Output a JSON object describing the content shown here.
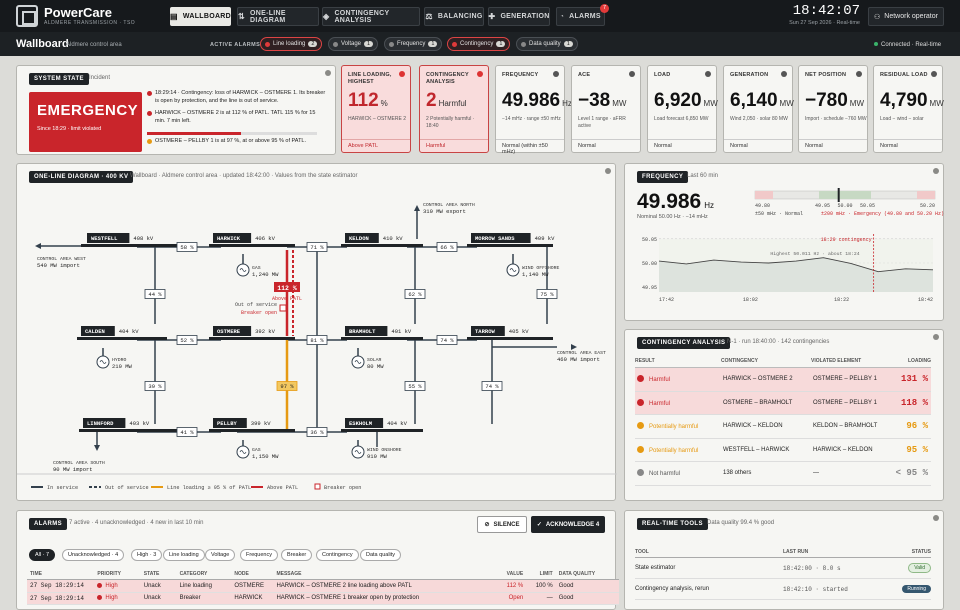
{
  "app": {
    "name": "PowerCare",
    "subtitle": "ALDMERE TRANSMISSION · TSO"
  },
  "nav": [
    {
      "label": "WALLBOARD",
      "icon": "▤"
    },
    {
      "label": "ONE-LINE DIAGRAM",
      "icon": "⇅"
    },
    {
      "label": "CONTINGENCY ANALYSIS",
      "icon": "◈"
    },
    {
      "label": "BALANCING",
      "icon": "⚖"
    },
    {
      "label": "GENERATION",
      "icon": "✚"
    },
    {
      "label": "ALARMS",
      "icon": "🔔"
    }
  ],
  "nav_badge": "7",
  "clock": {
    "time": "18:42:07",
    "date": "Sun 27 Sep 2026 · Real-time"
  },
  "operator": "Network operator",
  "subbar": {
    "title": "Wallboard",
    "subtitle": "Aldmere control area",
    "active_alarms_label": "ACTIVE ALARMS",
    "connected": "Connected · Real-time"
  },
  "alarm_chips": [
    {
      "label": "Line loading",
      "count": "2",
      "severity": "red"
    },
    {
      "label": "Voltage",
      "count": "1",
      "severity": "grey"
    },
    {
      "label": "Frequency",
      "count": "1",
      "severity": "grey"
    },
    {
      "label": "Contingency",
      "count": "1",
      "severity": "red"
    },
    {
      "label": "Data quality",
      "count": "1",
      "severity": "grey"
    }
  ],
  "system_state": {
    "title": "SYSTEM STATE",
    "tab": "Incident",
    "state": "EMERGENCY",
    "since": "Since 18:29 · limit violated",
    "incidents": [
      {
        "text": "18:29:14 · Contingency: loss of HARWICK – OSTMERE 1. Its breaker is open by protection, and the line is out of service."
      },
      {
        "text": "HARWICK – OSTMERE 2 is at 112 % of PATL. TATL 115 % for 15 min. 7 min left.",
        "progress": 0.55
      },
      {
        "text": "OSTMERE – PELLBY 1 is at 97 %, at or above 95 % of PATL."
      }
    ]
  },
  "kpis": [
    {
      "label": "LINE LOADING, HIGHEST",
      "value": "112",
      "unit": "%",
      "sub": "HARWICK – OSTMERE 2",
      "foot": "Above PATL",
      "alert": true
    },
    {
      "label": "CONTINGENCY ANALYSIS",
      "value": "2",
      "unit": "Harmful",
      "sub": "2 Potentially harmful · 18:40",
      "foot": "Harmful",
      "alert": true
    },
    {
      "label": "FREQUENCY",
      "value": "49.986",
      "unit": "Hz",
      "sub": "−14 mHz · range ±50 mHz",
      "foot": "Normal (within ±50 mHz)",
      "alert": false
    },
    {
      "label": "ACE",
      "value": "−38",
      "unit": "MW",
      "sub": "Level 1 range · aFRR active",
      "foot": "Normal",
      "alert": false
    },
    {
      "label": "LOAD",
      "value": "6,920",
      "unit": "MW",
      "sub": "Load forecast 6,850 MW",
      "foot": "Normal",
      "alert": false
    },
    {
      "label": "GENERATION",
      "value": "6,140",
      "unit": "MW",
      "sub": "Wind 2,050 · solar 80 MW",
      "foot": "Normal",
      "alert": false
    },
    {
      "label": "NET POSITION",
      "value": "−780",
      "unit": "MW",
      "sub": "Import · schedule −760 MW",
      "foot": "Normal",
      "alert": false
    },
    {
      "label": "RESIDUAL LOAD",
      "value": "4,790",
      "unit": "MW",
      "sub": "Load − wind − solar",
      "foot": "Normal",
      "alert": false
    }
  ],
  "one_line": {
    "title": "ONE-LINE DIAGRAM · 400 KV",
    "meta": "Wallboard · Aldmere control area · updated 18:42:00 · Values from the state estimator",
    "buses": [
      {
        "name": "WESTFELL",
        "kv": "408 kV"
      },
      {
        "name": "HARWICK",
        "kv": "406 kV"
      },
      {
        "name": "KELDON",
        "kv": "410 kV"
      },
      {
        "name": "MORROW SANDS",
        "kv": "409 kV"
      },
      {
        "name": "CALDEN",
        "kv": "404 kV"
      },
      {
        "name": "OSTMERE",
        "kv": "392 kV"
      },
      {
        "name": "BRAMHOLT",
        "kv": "401 kV"
      },
      {
        "name": "TARROW",
        "kv": "405 kV"
      },
      {
        "name": "LINNFORD",
        "kv": "403 kV"
      },
      {
        "name": "PELLBY",
        "kv": "399 kV"
      },
      {
        "name": "ESKHOLM",
        "kv": "404 kV"
      }
    ],
    "loadings": [
      "58 %",
      "71 %",
      "66 %",
      "44 %",
      "62 %",
      "75 %",
      "52 %",
      "81 %",
      "74 %",
      "39 %",
      "55 %",
      "74 %",
      "41 %",
      "36 %",
      "97 %",
      "112 %"
    ],
    "overload_label": "Above PATL",
    "out_of_service": "Out of service",
    "breaker_open": "Breaker open",
    "generators": [
      {
        "type": "GAS",
        "mw": "1,240 MW"
      },
      {
        "type": "WIND OFFSHORE",
        "mw": "1,140 MW"
      },
      {
        "type": "HYDRO",
        "mw": "210 MW"
      },
      {
        "type": "SOLAR",
        "mw": "80 MW"
      },
      {
        "type": "GAS",
        "mw": "1,150 MW"
      },
      {
        "type": "WIND ONSHORE",
        "mw": "910 MW"
      }
    ],
    "borders": [
      {
        "label": "CONTROL AREA WEST",
        "mw": "540 MW import"
      },
      {
        "label": "CONTROL AREA NORTH",
        "mw": "310 MW export"
      },
      {
        "label": "CONTROL AREA EAST",
        "mw": "460 MW import"
      },
      {
        "label": "CONTROL AREA SOUTH",
        "mw": "90 MW import"
      }
    ],
    "legend": [
      "In service",
      "Out of service",
      "Line loading ≥ 95 % of PATL",
      "Above PATL",
      "Breaker open"
    ]
  },
  "frequency": {
    "title": "FREQUENCY",
    "meta": "Last 60 min",
    "value": "49.986",
    "unit": "Hz",
    "nominal": "Nominal 50.00 Hz · −14 mHz",
    "scale_ticks": [
      "49.80",
      "49.95",
      "50.00",
      "50.05",
      "50.20"
    ],
    "scale_legend": [
      "±50 mHz · Normal",
      "±200 mHz · Emergency (49.80 and 50.20 Hz)"
    ],
    "chart_data": {
      "type": "line",
      "x": [
        "17:42",
        "17:48",
        "17:54",
        "18:00",
        "18:06",
        "18:12",
        "18:18",
        "18:24",
        "18:30",
        "18:36",
        "18:42"
      ],
      "y": [
        50.004,
        49.998,
        50.006,
        50.002,
        50.0,
        50.004,
        50.011,
        49.999,
        49.982,
        49.988,
        49.986
      ],
      "yticks": [
        "50.05",
        "50.00",
        "49.95"
      ],
      "ylim": [
        49.94,
        50.06
      ],
      "annotations": [
        "Highest 50.011 Hz · about 18:24",
        "18:29 contingency"
      ],
      "xtick_labels": [
        "17:42",
        "18:02",
        "18:22",
        "18:42"
      ]
    }
  },
  "contingency": {
    "title": "CONTINGENCY ANALYSIS",
    "meta": "N-1 · run 18:40:00 · 142 contingencies",
    "headers": [
      "RESULT",
      "CONTINGENCY",
      "VIOLATED ELEMENT",
      "LOADING"
    ],
    "rows": [
      {
        "result": "Harmful",
        "contingency": "HARWICK – OSTMERE 2",
        "violated": "OSTMERE – PELLBY 1",
        "loading": "131 %",
        "level": "red"
      },
      {
        "result": "Harmful",
        "contingency": "OSTMERE – BRAMHOLT",
        "violated": "OSTMERE – PELLBY 1",
        "loading": "118 %",
        "level": "red"
      },
      {
        "result": "Potentially harmful",
        "contingency": "HARWICK – KELDON",
        "violated": "KELDON – BRAMHOLT",
        "loading": "96 %",
        "level": "amber"
      },
      {
        "result": "Potentially harmful",
        "contingency": "WESTFELL – HARWICK",
        "violated": "HARWICK – KELDON",
        "loading": "95 %",
        "level": "amber"
      },
      {
        "result": "Not harmful",
        "contingency": "138 others",
        "violated": "—",
        "loading": "< 95 %",
        "level": "grey"
      }
    ]
  },
  "alarms": {
    "title": "ALARMS",
    "meta": "7 active · 4 unacknowledged · 4 new in last 10 min",
    "silence": "SILENCE",
    "ack": "ACKNOWLEDGE 4",
    "filters": [
      "All · 7",
      "Unacknowledged · 4",
      "High · 3",
      "Line loading",
      "Voltage",
      "Frequency",
      "Breaker",
      "Contingency",
      "Data quality"
    ],
    "headers": [
      "TIME",
      "PRIORITY",
      "STATE",
      "CATEGORY",
      "NODE",
      "MESSAGE",
      "VALUE",
      "LIMIT",
      "DATA QUALITY"
    ],
    "rows": [
      {
        "time": "27 Sep 18:29:14",
        "priority": "High",
        "state": "Unack",
        "category": "Line loading",
        "node": "OSTMERE",
        "message": "HARWICK – OSTMERE 2 line loading above PATL",
        "value": "112 %",
        "limit": "100 %",
        "dq": "Good"
      },
      {
        "time": "27 Sep 18:29:14",
        "priority": "High",
        "state": "Unack",
        "category": "Breaker",
        "node": "HARWICK",
        "message": "HARWICK – OSTMERE 1 breaker open by protection",
        "value": "Open",
        "limit": "—",
        "dq": "Good"
      }
    ]
  },
  "tools": {
    "title": "REAL-TIME TOOLS",
    "meta": "Data quality 99.4 % good",
    "headers": [
      "TOOL",
      "LAST RUN",
      "STATUS"
    ],
    "rows": [
      {
        "tool": "State estimator",
        "run": "18:42:00 · 8.0 s",
        "status": "Valid"
      },
      {
        "tool": "Contingency analysis, rerun",
        "run": "18:42:10 · started",
        "status": "Running"
      }
    ]
  },
  "colors": {
    "alert": "#c9252b",
    "amber": "#e69a12",
    "dark": "#1f2326",
    "ok": "#3ab36a"
  }
}
